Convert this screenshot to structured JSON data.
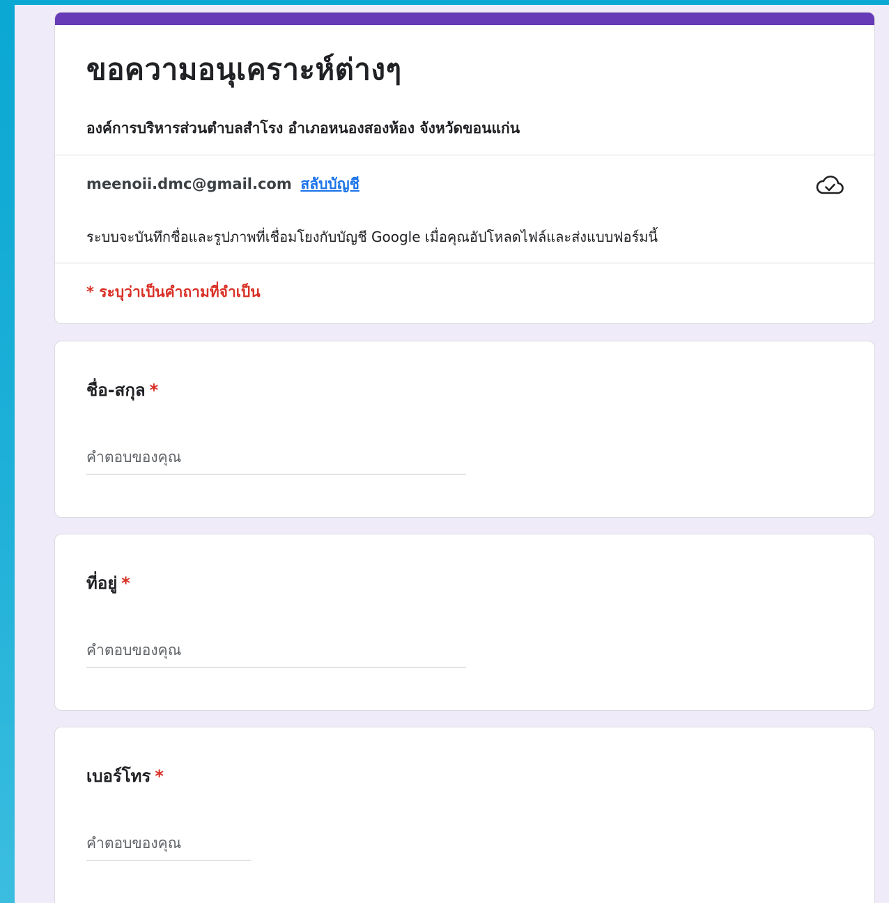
{
  "form": {
    "title": "ขอความอนุเคราะห์ต่างๆ",
    "description": "องค์การบริหารส่วนตำบลสำโรง อำเภอหนองสองห้อง จังหวัดขอนแก่น",
    "accent_color": "#673ab7",
    "background_color": "#f0ebf8"
  },
  "account": {
    "email": "meenoii.dmc@gmail.com",
    "switch_label": "สลับบัญชี",
    "status_icon": "cloud-check-icon",
    "notice": "ระบบจะบันทึกชื่อและรูปภาพที่เชื่อมโยงกับบัญชี Google เมื่อคุณอัปโหลดไฟล์และส่งแบบฟอร์มนี้"
  },
  "required_note": "* ระบุว่าเป็นคำถามที่จำเป็น",
  "questions": [
    {
      "label": "ชื่อ-สกุล",
      "required_mark": "*",
      "placeholder": "คำตอบของคุณ",
      "value": ""
    },
    {
      "label": "ที่อยู่",
      "required_mark": "*",
      "placeholder": "คำตอบของคุณ",
      "value": ""
    },
    {
      "label": "เบอร์โทร",
      "required_mark": "*",
      "placeholder": "คำตอบของคุณ",
      "value": ""
    }
  ]
}
